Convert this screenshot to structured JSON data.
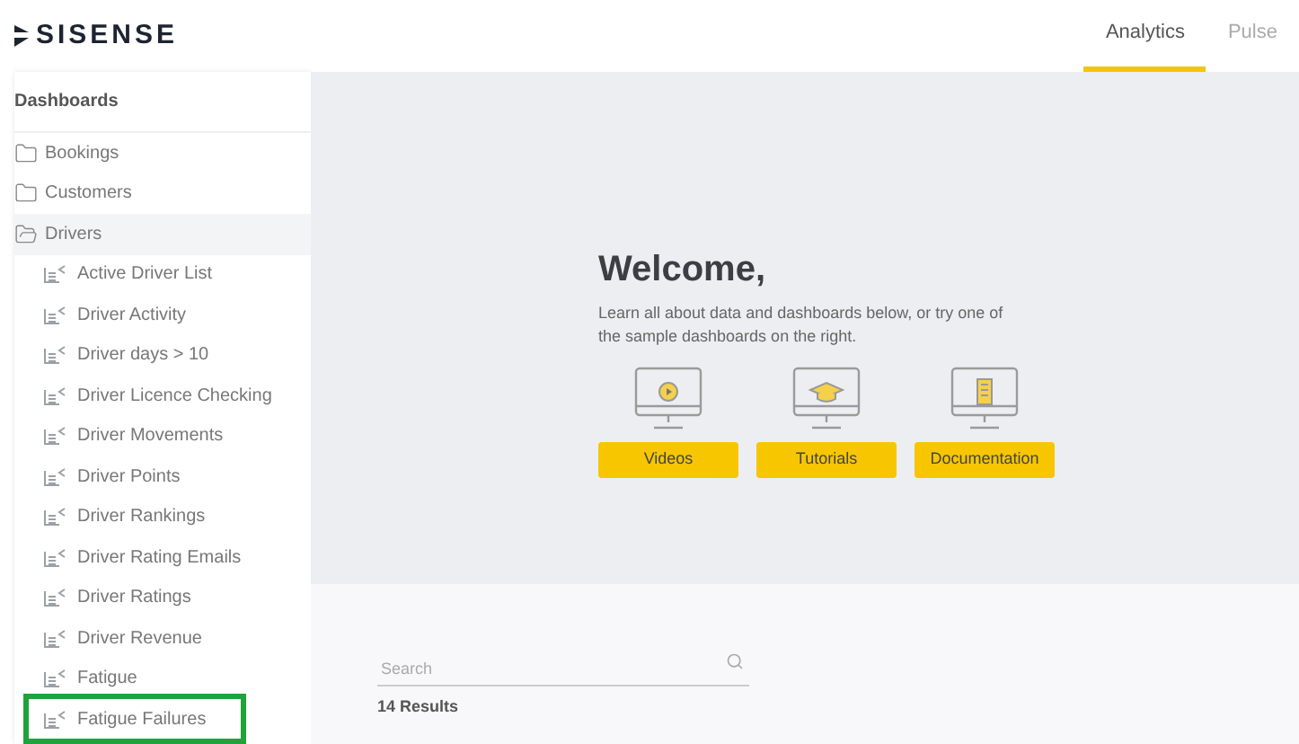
{
  "header": {
    "logo": "SISENSE",
    "tabs": [
      {
        "label": "Analytics",
        "selected": true
      },
      {
        "label": "Pulse",
        "selected": false
      }
    ]
  },
  "sidebar": {
    "title": "Dashboards",
    "items": [
      {
        "label": "Bookings",
        "expanded": false,
        "highlighted": false
      },
      {
        "label": "Customers",
        "expanded": false,
        "highlighted": false
      },
      {
        "label": "Drivers",
        "expanded": true,
        "highlighted": false,
        "children": [
          {
            "label": "Active Driver List",
            "highlighted": false
          },
          {
            "label": "Driver Activity",
            "highlighted": false
          },
          {
            "label": "Driver days > 10",
            "highlighted": false
          },
          {
            "label": "Driver Licence Checking",
            "highlighted": false
          },
          {
            "label": "Driver Movements",
            "highlighted": false
          },
          {
            "label": "Driver Points",
            "highlighted": false
          },
          {
            "label": "Driver Rankings",
            "highlighted": false
          },
          {
            "label": "Driver Rating Emails",
            "highlighted": false
          },
          {
            "label": "Driver Ratings",
            "highlighted": false
          },
          {
            "label": "Driver Revenue",
            "highlighted": false
          },
          {
            "label": "Fatigue",
            "highlighted": false
          },
          {
            "label": "Fatigue Failures",
            "highlighted": true
          }
        ]
      }
    ]
  },
  "welcome": {
    "title": "Welcome,",
    "text": "Learn all about data and dashboards below, or try one of the sample dashboards on the right.",
    "cards": [
      {
        "kind": "video",
        "label": "Videos"
      },
      {
        "kind": "tutorial",
        "label": "Tutorials"
      },
      {
        "kind": "document",
        "label": "Documentation"
      }
    ]
  },
  "search": {
    "placeholder": "Search"
  },
  "results": "14 Results"
}
